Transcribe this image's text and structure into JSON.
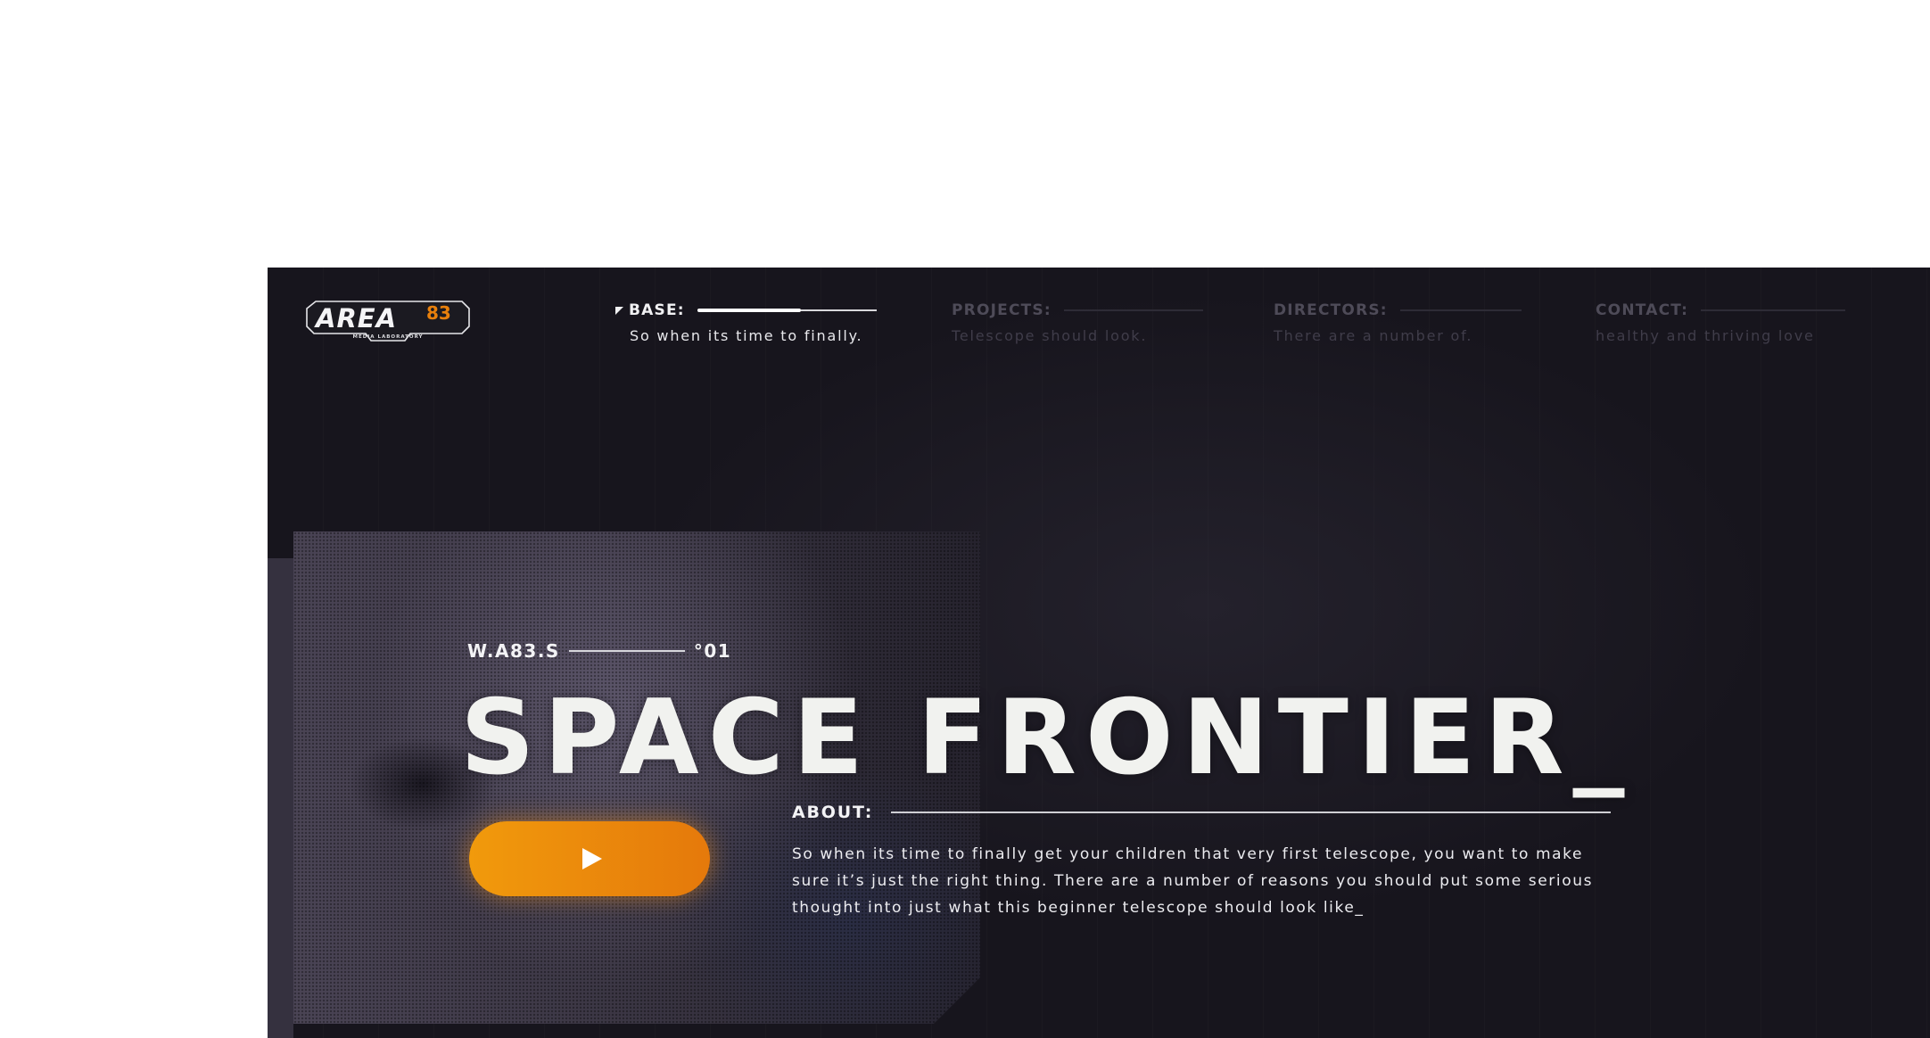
{
  "brand": {
    "logo_text": "AREA",
    "logo_number": "83",
    "logo_subtitle": "MEDIA LABORATORY",
    "accent_color": "#e8800c"
  },
  "nav": [
    {
      "label": "BASE:",
      "subtitle": "So when its time to finally.",
      "active": true
    },
    {
      "label": "PROJECTS:",
      "subtitle": "Telescope should look.",
      "active": false
    },
    {
      "label": "DIRECTORS:",
      "subtitle": "There are a number of.",
      "active": false
    },
    {
      "label": "CONTACT:",
      "subtitle": "healthy and thriving love",
      "active": false
    }
  ],
  "hero": {
    "code": "W.A83.S",
    "index": "°01",
    "title": "SPACE FRONTIER_",
    "play_icon": "play-icon"
  },
  "about": {
    "label": "ABOUT:",
    "text": "So when its time to finally get your children that very first telescope, you want to make sure it’s just the right thing. There are a number of reasons you should put some serious thought into just what this beginner telescope should look like_"
  }
}
